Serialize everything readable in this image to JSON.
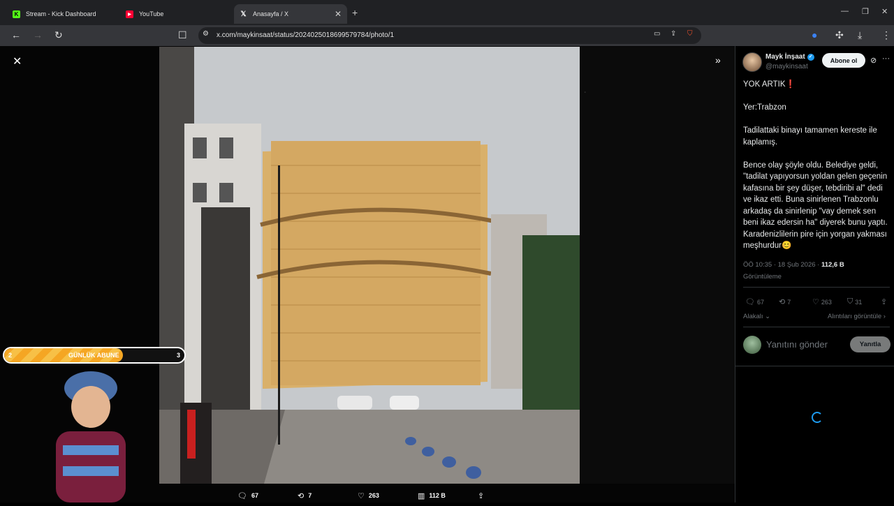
{
  "tabs": [
    {
      "title": "Stream - Kick Dashboard",
      "icon": "kick-icon"
    },
    {
      "title": "YouTube",
      "icon": "youtube-icon"
    },
    {
      "title": "Anasayfa / X",
      "icon": "x-icon"
    }
  ],
  "address": {
    "url": "x.com/maykinsaat/status/2024025018699579784/photo/1"
  },
  "photo_stats": {
    "replies": "67",
    "reposts": "7",
    "likes": "263",
    "views": "112 B"
  },
  "author": {
    "name": "Mayk İnşaat",
    "handle": "@maykinsaat",
    "follow_label": "Abone ol"
  },
  "tweet": {
    "paragraphs": [
      "YOK ARTIK❗",
      "Yer:Trabzon",
      "Tadilattaki binayı tamamen kereste ile kaplamış.",
      "Bence olay şöyle oldu. Belediye geldi, \"tadilat yapıyorsun yoldan gelen geçenin kafasına bir şey düşer, tebdiribi al\" dedi ve ikaz etti. Buna sinirlenen Trabzonlu arkadaş da sinirlenip \"vay demek sen beni ikaz edersin ha\" diyerek bunu yaptı. Karadenizlilerin pire için yorgan yakması meşhurdur😊"
    ],
    "time": "ÖÖ 10:35 · 18 Şub 2026 · ",
    "views": "112,6 B",
    "views_label": "Görüntüleme"
  },
  "actions": {
    "replies": "67",
    "reposts": "7",
    "likes": "263",
    "bookmarks": "31"
  },
  "links": {
    "related": "Alakalı",
    "quotes": "Alıntıları görüntüle"
  },
  "reply": {
    "placeholder": "Yanıtını gönder",
    "button": "Yanıtla"
  },
  "overlay": {
    "left": "2",
    "right": "3",
    "label": "GÜNLÜK ABUNE",
    "progress": 0.66
  },
  "colors": {
    "accent": "#1d9bf0",
    "bar": "#f5a623"
  }
}
